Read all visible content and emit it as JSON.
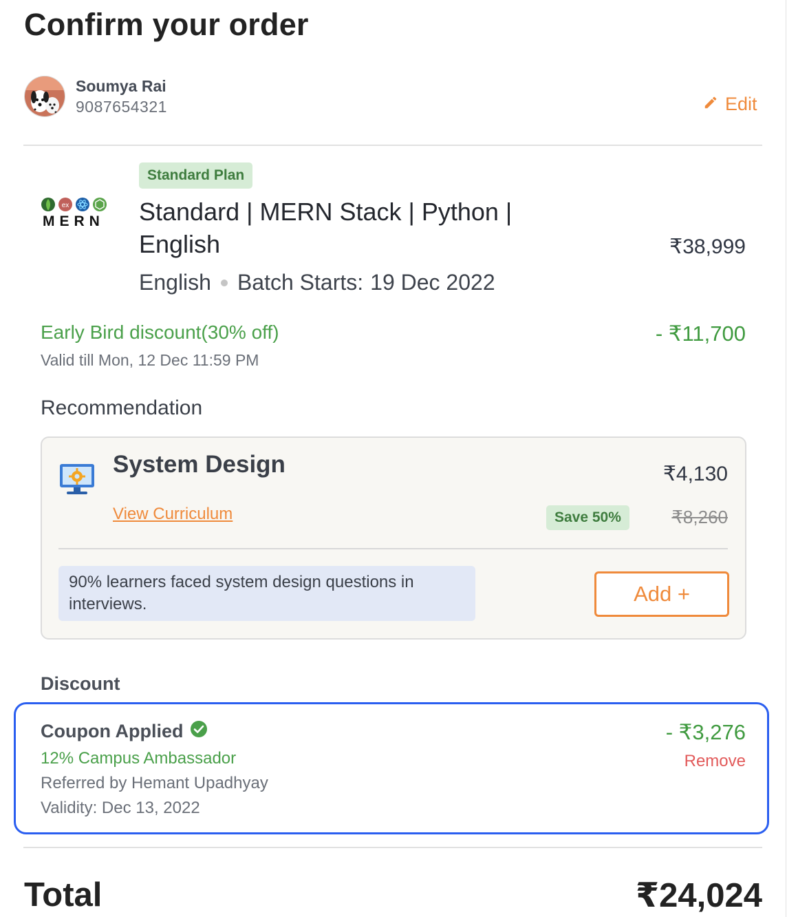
{
  "header": {
    "title": "Confirm your order"
  },
  "user": {
    "name": "Soumya Rai",
    "phone": "9087654321",
    "edit_label": "Edit"
  },
  "course": {
    "plan_badge": "Standard Plan",
    "logo_text": "MERN",
    "title": "Standard | MERN Stack | Python | English",
    "language": "English",
    "batch_label": "Batch Starts:",
    "batch_date": "19 Dec 2022",
    "price": "₹38,999"
  },
  "early_bird": {
    "label": "Early Bird discount(30% off)",
    "valid": "Valid till Mon, 12 Dec 11:59 PM",
    "amount": "- ₹11,700"
  },
  "recommendation": {
    "heading": "Recommendation",
    "title": "System Design",
    "price": "₹4,130",
    "link": "View Curriculum",
    "save_badge": "Save 50%",
    "original_price": "₹8,260",
    "info": "90% learners faced system design questions in interviews.",
    "add_label": "Add +"
  },
  "discount": {
    "heading": "Discount",
    "coupon_title": "Coupon Applied",
    "coupon_name": "12% Campus Ambassador",
    "referred_by": "Referred by Hemant Upadhyay",
    "validity": "Validity: Dec 13, 2022",
    "amount": "- ₹3,276",
    "remove_label": "Remove"
  },
  "total": {
    "label": "Total",
    "amount": "₹24,024"
  },
  "colors": {
    "accent": "#ef8a3b",
    "success": "#4aa04a",
    "danger": "#e25a5a",
    "highlight": "#2a5ef0",
    "badge_bg": "#d6ecd6",
    "info_bg": "#e2e8f6"
  },
  "icons": {
    "edit": "pencil-icon",
    "avatar": "dalmatian-avatar",
    "logo": "mern-logo",
    "course_icon": "monitor-gear-icon",
    "coupon_check": "check-circle-icon"
  }
}
